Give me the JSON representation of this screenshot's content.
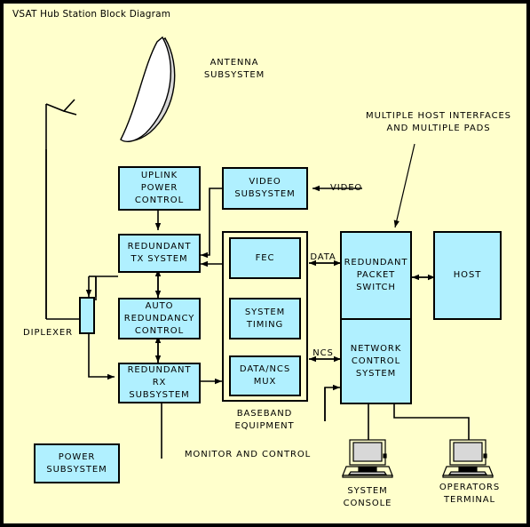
{
  "title": "VSAT Hub Station Block Diagram",
  "colors": {
    "background": "#ffffcc",
    "box_fill": "#b0f0ff",
    "border": "#000000",
    "frame": "#000000",
    "screen_fill": "#d8d8d8",
    "dish_fill": "#ffffff",
    "dish_shadow": "#d8d8d8"
  },
  "blocks": {
    "uplink_power_control": "UPLINK\nPOWER\nCONTROL",
    "video_subsystem": "VIDEO\nSUBSYSTEM",
    "redundant_tx_system": "REDUNDANT\nTX SYSTEM",
    "auto_redundancy_control": "AUTO\nREDUNDANCY\nCONTROL",
    "redundant_rx_subsystem": "REDUNDANT\nRX\nSUBSYSTEM",
    "power_subsystem": "POWER\nSUBSYSTEM",
    "fec": "FEC",
    "system_timing": "SYSTEM\nTIMING",
    "data_ncs_mux": "DATA/NCS\nMUX",
    "redundant_packet_switch": "REDUNDANT\nPACKET\nSWITCH",
    "network_control_system": "NETWORK\nCONTROL\nSYSTEM",
    "host": "HOST"
  },
  "labels": {
    "antenna_subsystem": "ANTENNA\nSUBSYSTEM",
    "multiple_host_interfaces": "MULTIPLE HOST INTERFACES\nAND MULTIPLE PADS",
    "video": "VIDEO",
    "data": "DATA",
    "ncs": "NCS",
    "diplexer": "DIPLEXER",
    "baseband_equipment": "BASEBAND\nEQUIPMENT",
    "monitor_and_control": "MONITOR AND CONTROL",
    "system_console": "SYSTEM\nCONSOLE",
    "operators_terminal": "OPERATORS\nTERMINAL"
  }
}
